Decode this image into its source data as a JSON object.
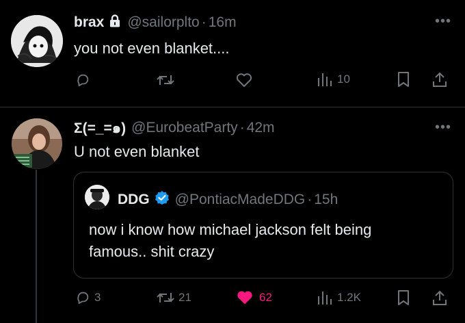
{
  "tweet1": {
    "display_name": "brax",
    "handle": "@sailorplto",
    "separator": "·",
    "time": "16m",
    "text": "you not even blanket....",
    "views": "10",
    "avatar_icon": "manga-avatar-icon"
  },
  "tweet2": {
    "display_name": "Σ(=_=๑)",
    "handle": "@EurobeatParty",
    "separator": "·",
    "time": "42m",
    "text": "U not even blanket",
    "replies": "3",
    "retweets": "21",
    "likes": "62",
    "views": "1.2K",
    "liked": true,
    "avatar_icon": "photo-avatar-icon"
  },
  "quote": {
    "display_name": "DDG",
    "handle": "@PontiacMadeDDG",
    "separator": "·",
    "time": "15h",
    "text_line1": "now i know how michael jackson felt being",
    "text_line2": "famous.. shit crazy",
    "verified": true
  },
  "colors": {
    "background": "#000000",
    "text": "#e7e9ea",
    "muted": "#71767b",
    "like": "#f91880",
    "verified": "#1d9bf0",
    "border": "#2f3336"
  }
}
